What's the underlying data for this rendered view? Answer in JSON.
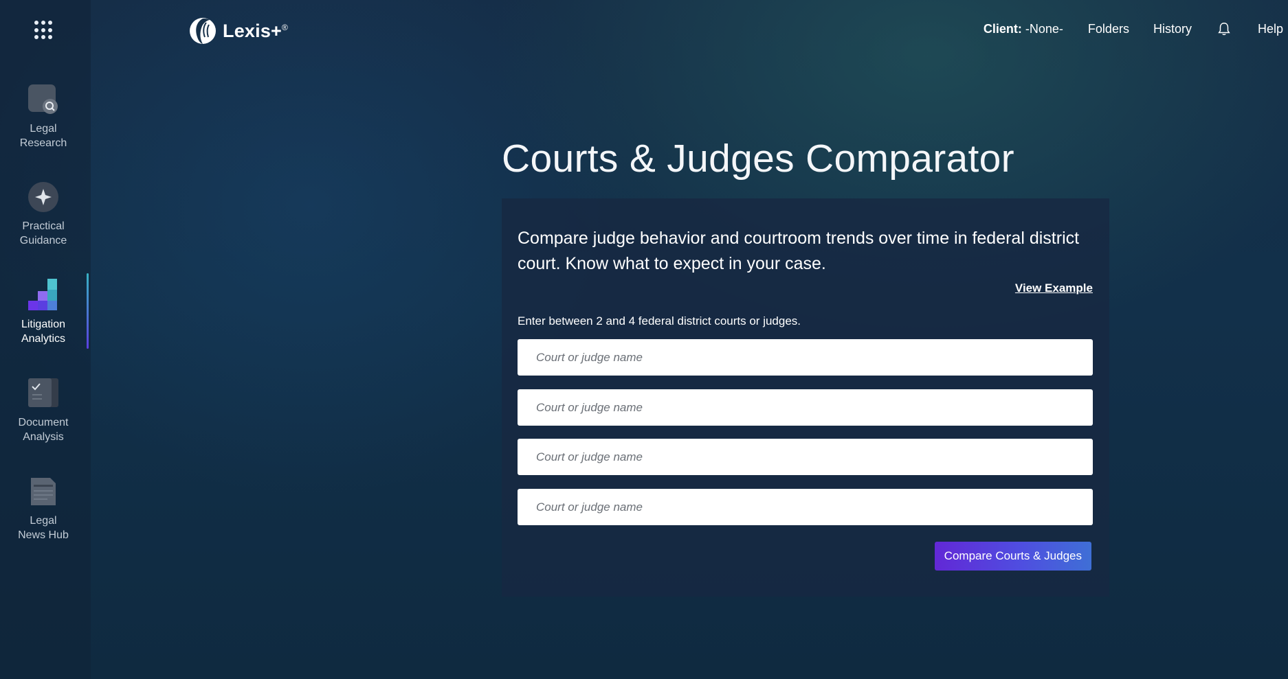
{
  "app": {
    "name": "Lexis+",
    "logo_mark": "®"
  },
  "header": {
    "client_label": "Client:",
    "client_value": " -None-",
    "folders": "Folders",
    "history": "History",
    "help": "Help",
    "notification_icon": "bell-icon"
  },
  "sidebar": {
    "menu_icon": "apps-grid-icon",
    "items": [
      {
        "line1": "Legal",
        "line2": "Research",
        "icon": "legal-research-icon",
        "active": false
      },
      {
        "line1": "Practical",
        "line2": "Guidance",
        "icon": "compass-icon",
        "active": false
      },
      {
        "line1": "Litigation",
        "line2": "Analytics",
        "icon": "bar-chart-icon",
        "active": true
      },
      {
        "line1": "Document",
        "line2": "Analysis",
        "icon": "document-check-icon",
        "active": false
      },
      {
        "line1": "Legal",
        "line2": "News Hub",
        "icon": "newspaper-icon",
        "active": false
      }
    ]
  },
  "main": {
    "title": "Courts & Judges Comparator",
    "description": "Compare judge behavior and courtroom trends over time in federal district court. Know what to expect in your case.",
    "view_example": "View Example",
    "instructions": "Enter between 2 and 4 federal district courts or judges.",
    "fields": [
      {
        "placeholder": "Court or judge name",
        "value": ""
      },
      {
        "placeholder": "Court or judge name",
        "value": ""
      },
      {
        "placeholder": "Court or judge name",
        "value": ""
      },
      {
        "placeholder": "Court or judge name",
        "value": ""
      }
    ],
    "submit_label": "Compare Courts & Judges"
  },
  "colors": {
    "accent_start": "#6228d6",
    "accent_end": "#3f6fd6",
    "active_bar_top": "#38b3c4",
    "active_bar_bottom": "#5a3ee0"
  }
}
